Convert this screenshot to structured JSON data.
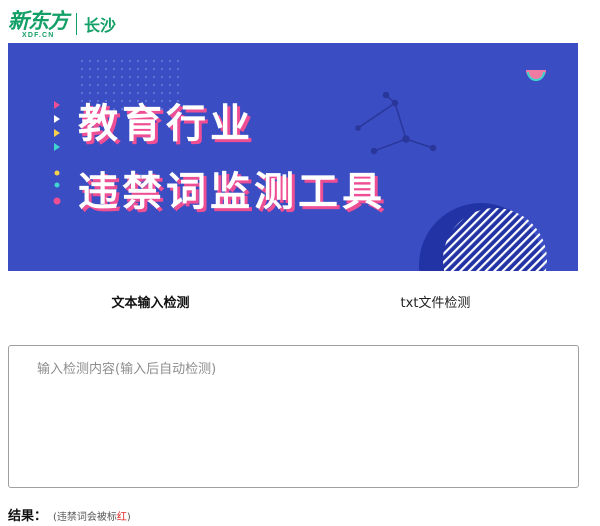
{
  "header": {
    "logo_main": "新东方",
    "logo_sub": "XDF.CN",
    "city": "长沙"
  },
  "banner": {
    "title_line1": "教育行业",
    "title_line2": "违禁词监测工具",
    "background_color": "#3a4dc3",
    "accent_color": "#ee4e94"
  },
  "tabs": [
    {
      "label": "文本输入检测",
      "active": true
    },
    {
      "label": "txt文件检测",
      "active": false
    }
  ],
  "input": {
    "placeholder": "输入检测内容(输入后自动检测)",
    "value": ""
  },
  "result": {
    "label": "结果：",
    "note_prefix": "(违禁词会被标",
    "note_red": "红",
    "note_suffix": ")"
  },
  "colors": {
    "brand_green": "#13a067",
    "highlight_red": "#e02020"
  }
}
